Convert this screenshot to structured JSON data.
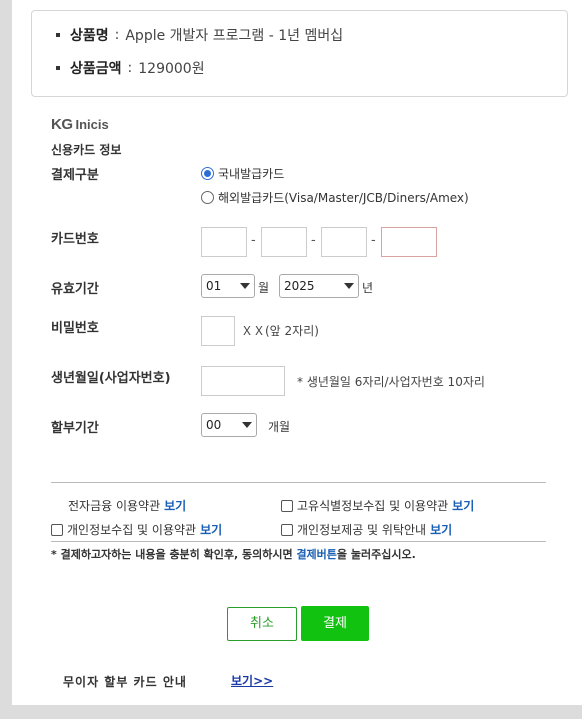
{
  "product": {
    "name_label": "상품명",
    "name_value": "Apple 개발자 프로그램 - 1년 멤버십",
    "price_label": "상품금액",
    "price_value": "129000원",
    "separator": ":"
  },
  "logo": {
    "kg": "KG",
    "inicis": "Inicis"
  },
  "section_title": "신용카드 정보",
  "payment_type": {
    "label": "결제구분",
    "options": [
      {
        "label": "국내발급카드",
        "selected": true
      },
      {
        "label": "해외발급카드(Visa/Master/JCB/Diners/Amex)",
        "selected": false
      }
    ]
  },
  "card_number": {
    "label": "카드번호",
    "dash": "-"
  },
  "expiry": {
    "label": "유효기간",
    "month_value": "01",
    "month_unit": "월",
    "year_value": "2025",
    "year_unit": "년"
  },
  "password": {
    "label": "비밀번호",
    "hint": "ＸＸ(앞 2자리)"
  },
  "birth": {
    "label": "생년월일(사업자번호)",
    "hint": "* 생년월일 6자리/사업자번호 10자리"
  },
  "installment": {
    "label": "할부기간",
    "value": "00",
    "unit": "개월"
  },
  "agreements": {
    "link_text": "보기",
    "items": [
      {
        "text": "전자금융 이용약관",
        "has_checkbox": false
      },
      {
        "text": "고유식별정보수집 및 이용약관",
        "has_checkbox": true
      },
      {
        "text": "개인정보수집 및 이용약관",
        "has_checkbox": true
      },
      {
        "text": "개인정보제공 및 위탁안내",
        "has_checkbox": true
      }
    ]
  },
  "notice": {
    "before": "* 결제하고자하는 내용을 충분히 확인후, 동의하시면 ",
    "highlight": "결제버튼",
    "after": "을 눌러주십시오."
  },
  "buttons": {
    "cancel": "취소",
    "pay": "결제"
  },
  "footer": {
    "label": "무이자 할부 카드 안내",
    "link": "보기>>"
  },
  "colors": {
    "accent_green": "#11c211",
    "link_blue": "#1a5fb4"
  }
}
